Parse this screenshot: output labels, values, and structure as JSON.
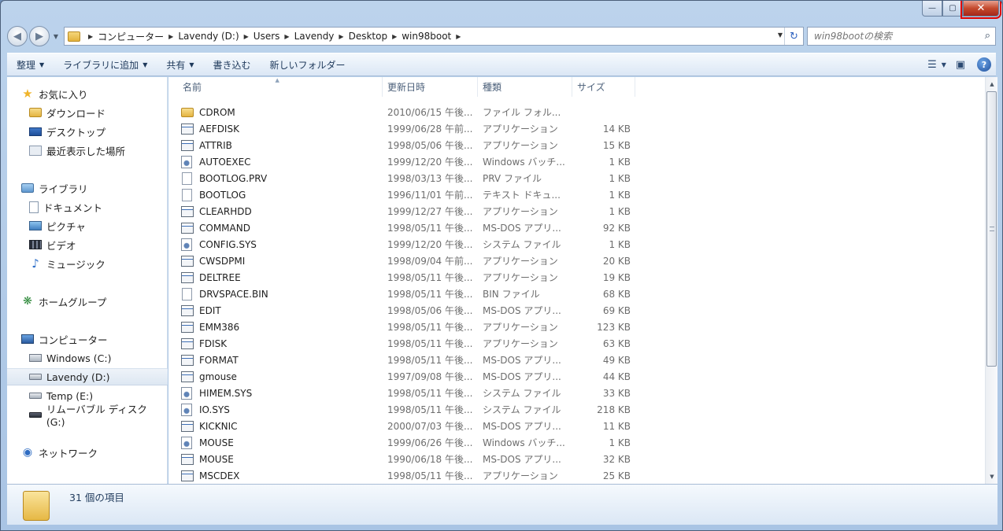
{
  "window": {
    "caption": {
      "minimize": "—",
      "maximize": "▢",
      "close": "✕"
    }
  },
  "address": {
    "crumbs": [
      "コンピューター",
      "Lavendy (D:)",
      "Users",
      "Lavendy",
      "Desktop",
      "win98boot"
    ]
  },
  "search": {
    "placeholder": "win98bootの検索"
  },
  "toolbar": {
    "organize": "整理",
    "add_to_library": "ライブラリに追加",
    "share": "共有",
    "burn": "書き込む",
    "new_folder": "新しいフォルダー"
  },
  "nav": {
    "favorites": "お気に入り",
    "downloads": "ダウンロード",
    "desktop": "デスクトップ",
    "recent": "最近表示した場所",
    "libraries": "ライブラリ",
    "documents": "ドキュメント",
    "pictures": "ピクチャ",
    "videos": "ビデオ",
    "music": "ミュージック",
    "homegroup": "ホームグループ",
    "computer": "コンピューター",
    "drive_c": "Windows (C:)",
    "drive_d": "Lavendy (D:)",
    "drive_e": "Temp (E:)",
    "drive_g": "リムーバブル ディスク (G:)",
    "network": "ネットワーク"
  },
  "columns": {
    "name": "名前",
    "date": "更新日時",
    "type": "種類",
    "size": "サイズ"
  },
  "files": [
    {
      "name": "CDROM",
      "date": "2010/06/15 午後...",
      "type": "ファイル フォル...",
      "size": "",
      "icon": "folder"
    },
    {
      "name": "AEFDISK",
      "date": "1999/06/28 午前...",
      "type": "アプリケーション",
      "size": "14 KB",
      "icon": "app"
    },
    {
      "name": "ATTRIB",
      "date": "1998/05/06 午後...",
      "type": "アプリケーション",
      "size": "15 KB",
      "icon": "app"
    },
    {
      "name": "AUTOEXEC",
      "date": "1999/12/20 午後...",
      "type": "Windows バッチ...",
      "size": "1 KB",
      "icon": "cfg"
    },
    {
      "name": "BOOTLOG.PRV",
      "date": "1998/03/13 午後...",
      "type": "PRV ファイル",
      "size": "1 KB",
      "icon": "doc"
    },
    {
      "name": "BOOTLOG",
      "date": "1996/11/01 午前...",
      "type": "テキスト ドキュ...",
      "size": "1 KB",
      "icon": "doc"
    },
    {
      "name": "CLEARHDD",
      "date": "1999/12/27 午後...",
      "type": "アプリケーション",
      "size": "1 KB",
      "icon": "app"
    },
    {
      "name": "COMMAND",
      "date": "1998/05/11 午後...",
      "type": "MS-DOS アプリ...",
      "size": "92 KB",
      "icon": "app"
    },
    {
      "name": "CONFIG.SYS",
      "date": "1999/12/20 午後...",
      "type": "システム ファイル",
      "size": "1 KB",
      "icon": "cfg"
    },
    {
      "name": "CWSDPMI",
      "date": "1998/09/04 午前...",
      "type": "アプリケーション",
      "size": "20 KB",
      "icon": "app"
    },
    {
      "name": "DELTREE",
      "date": "1998/05/11 午後...",
      "type": "アプリケーション",
      "size": "19 KB",
      "icon": "app"
    },
    {
      "name": "DRVSPACE.BIN",
      "date": "1998/05/11 午後...",
      "type": "BIN ファイル",
      "size": "68 KB",
      "icon": "doc"
    },
    {
      "name": "EDIT",
      "date": "1998/05/06 午後...",
      "type": "MS-DOS アプリ...",
      "size": "69 KB",
      "icon": "app"
    },
    {
      "name": "EMM386",
      "date": "1998/05/11 午後...",
      "type": "アプリケーション",
      "size": "123 KB",
      "icon": "app"
    },
    {
      "name": "FDISK",
      "date": "1998/05/11 午後...",
      "type": "アプリケーション",
      "size": "63 KB",
      "icon": "app"
    },
    {
      "name": "FORMAT",
      "date": "1998/05/11 午後...",
      "type": "MS-DOS アプリ...",
      "size": "49 KB",
      "icon": "app"
    },
    {
      "name": "gmouse",
      "date": "1997/09/08 午後...",
      "type": "MS-DOS アプリ...",
      "size": "44 KB",
      "icon": "app"
    },
    {
      "name": "HIMEM.SYS",
      "date": "1998/05/11 午後...",
      "type": "システム ファイル",
      "size": "33 KB",
      "icon": "cfg"
    },
    {
      "name": "IO.SYS",
      "date": "1998/05/11 午後...",
      "type": "システム ファイル",
      "size": "218 KB",
      "icon": "cfg"
    },
    {
      "name": "KICKNIC",
      "date": "2000/07/03 午後...",
      "type": "MS-DOS アプリ...",
      "size": "11 KB",
      "icon": "app"
    },
    {
      "name": "MOUSE",
      "date": "1999/06/26 午後...",
      "type": "Windows バッチ...",
      "size": "1 KB",
      "icon": "cfg"
    },
    {
      "name": "MOUSE",
      "date": "1990/06/18 午後...",
      "type": "MS-DOS アプリ...",
      "size": "32 KB",
      "icon": "app"
    },
    {
      "name": "MSCDEX",
      "date": "1998/05/11 午後...",
      "type": "アプリケーション",
      "size": "25 KB",
      "icon": "app"
    }
  ],
  "status": {
    "count": "31 個の項目"
  }
}
